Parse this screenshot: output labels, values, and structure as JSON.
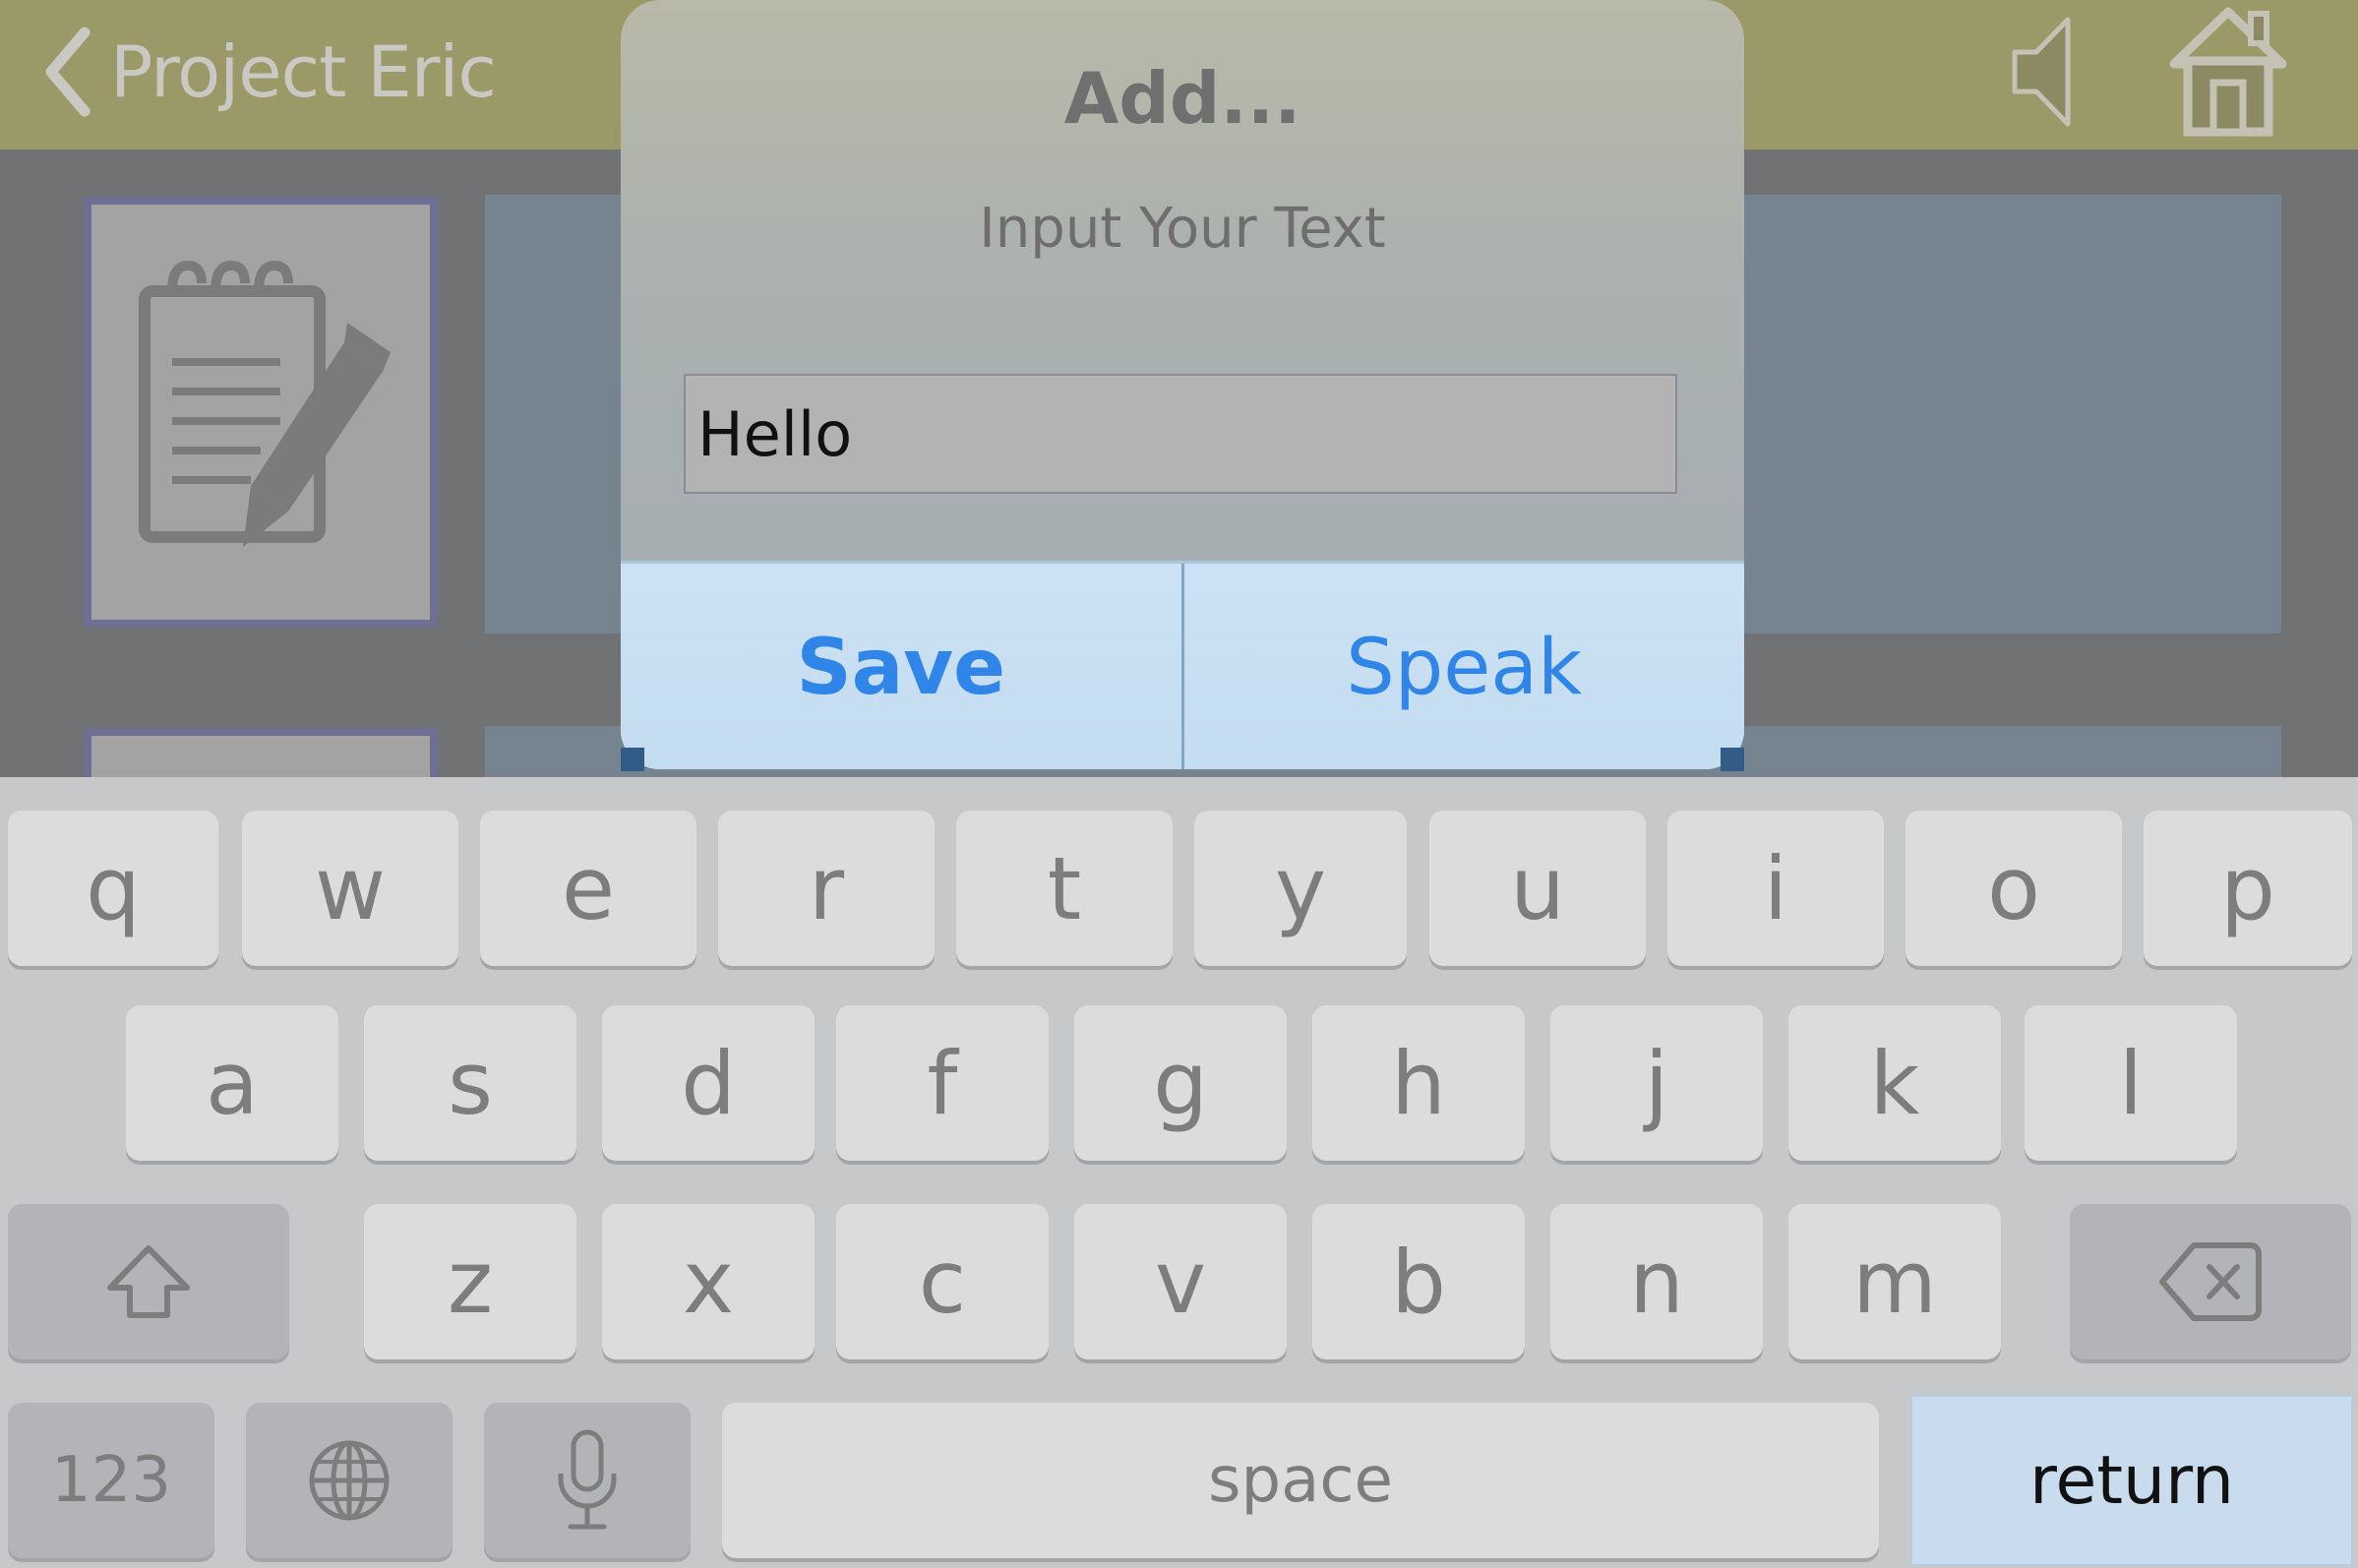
{
  "navbar": {
    "back_label": "Project Eric",
    "back_icon": "chevron-left-icon",
    "speaker_icon": "speaker-icon",
    "home_icon": "home-icon"
  },
  "content": {
    "tile_icon": "notepad-pencil-icon"
  },
  "alert": {
    "title": "Add...",
    "message": "Input Your Text",
    "input_value": "Hello",
    "buttons": {
      "save": "Save",
      "speak": "Speak"
    }
  },
  "keyboard": {
    "row1": [
      "q",
      "w",
      "e",
      "r",
      "t",
      "y",
      "u",
      "i",
      "o",
      "p"
    ],
    "row2": [
      "a",
      "s",
      "d",
      "f",
      "g",
      "h",
      "j",
      "k",
      "l"
    ],
    "row3": [
      "z",
      "x",
      "c",
      "v",
      "b",
      "n",
      "m"
    ],
    "shift_icon": "shift-icon",
    "delete_icon": "backspace-icon",
    "numbers_label": "123",
    "globe_icon": "globe-icon",
    "mic_icon": "microphone-icon",
    "space_label": "space",
    "return_label": "return"
  },
  "colors": {
    "navbar": "#9c9968",
    "alert_button_text": "#2f86e8",
    "return_key": "#c9dcee",
    "keyboard_bg": "#c7c8ca"
  }
}
